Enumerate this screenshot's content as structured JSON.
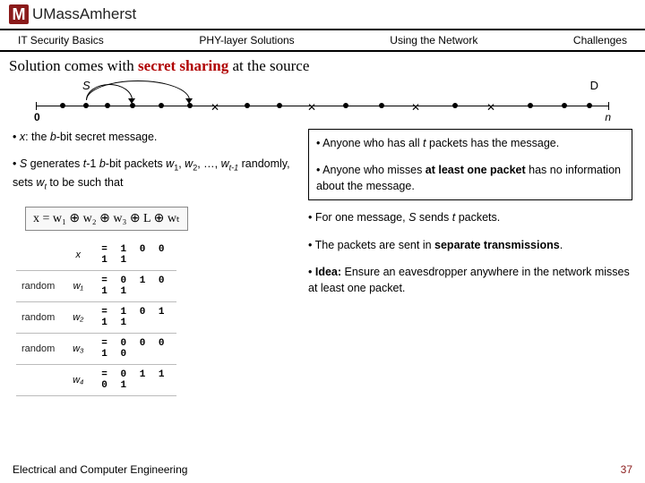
{
  "logo": {
    "mark": "M",
    "text1": "UMass",
    "text2": "Amherst"
  },
  "tabs": {
    "t1": "IT Security Basics",
    "t2": "PHY-layer Solutions",
    "t3": "Using the Network",
    "t4": "Challenges"
  },
  "title": {
    "a": "Solution comes with ",
    "b": "secret sharing",
    "c": " at the source"
  },
  "diagram": {
    "S": "S",
    "D": "D",
    "zero": "0",
    "n": "n"
  },
  "left": {
    "b1a": "• ",
    "b1b": "x",
    "b1c": ": the ",
    "b1d": "b",
    "b1e": "-bit secret message.",
    "b2a": "• ",
    "b2b": "S",
    "b2c": " generates ",
    "b2d": "t",
    "b2e": "-1 ",
    "b2f": "b",
    "b2g": "-bit packets ",
    "b2h": "w",
    "b2i": "1",
    "b2j": ", ",
    "b2k": "w",
    "b2l": "2",
    "b2m": ", …, ",
    "b2n": "w",
    "b2o": "t-1",
    "b2p": " randomly, sets ",
    "b2q": "w",
    "b2r": "t",
    "b2s": " to be such that",
    "eq": "x = w₁ ⊕ w₂ ⊕ w₃ ⊕ L ⊕ wₜ"
  },
  "table": {
    "r0": {
      "lab": "",
      "var": "x",
      "eq": "= 1 0 0 1 1"
    },
    "r1": {
      "lab": "random",
      "var": "w₁",
      "eq": "= 0 1 0 1 1"
    },
    "r2": {
      "lab": "random",
      "var": "w₂",
      "eq": "= 1 0 1 1 1"
    },
    "r3": {
      "lab": "random",
      "var": "w₃",
      "eq": "= 0 0 0 1 0"
    },
    "r4": {
      "lab": "",
      "var": "w₄",
      "eq": "= 0 1 1 0 1"
    }
  },
  "right": {
    "b1a": "• Anyone who has all ",
    "b1b": "t",
    "b1c": " packets has the message.",
    "b2a": "• Anyone who misses ",
    "b2b": "at least one packet",
    "b2c": " has no information about the message.",
    "b3a": "• For one message, ",
    "b3b": "S",
    "b3c": " sends ",
    "b3d": "t",
    "b3e": " packets.",
    "b4a": "• The packets are sent in ",
    "b4b": "separate transmissions",
    "b4c": ".",
    "b5a": "• ",
    "b5b": "Idea:",
    "b5c": " Ensure an eavesdropper anywhere in the network misses at least one packet."
  },
  "footer": {
    "dept": "Electrical and Computer Engineering",
    "page": "37"
  }
}
